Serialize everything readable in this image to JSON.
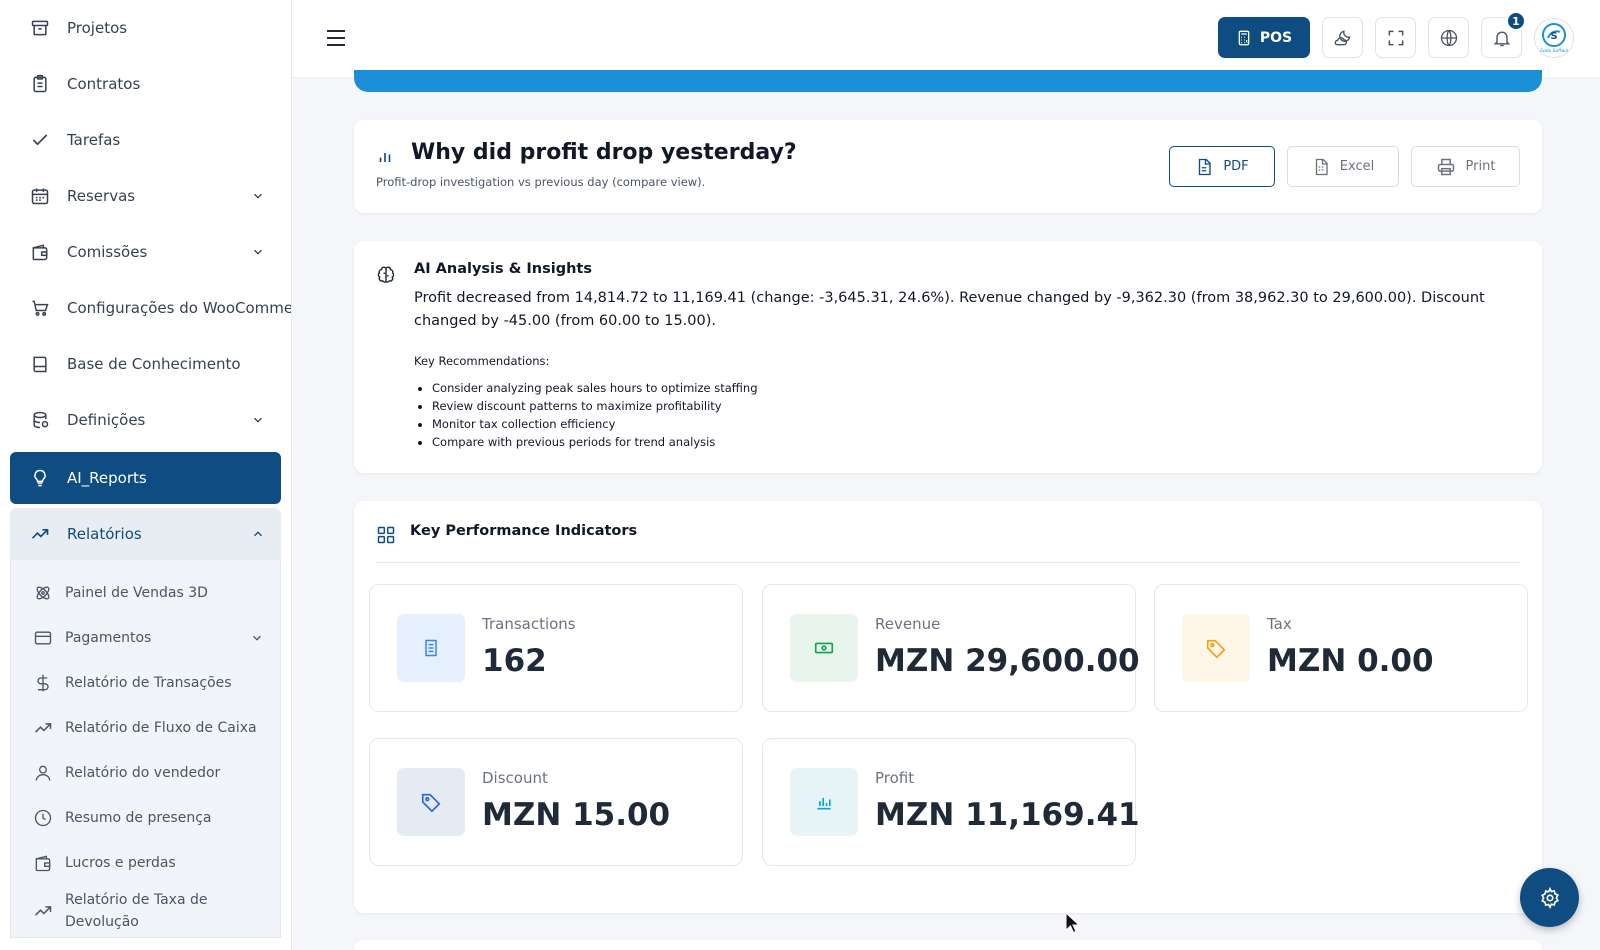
{
  "sidebar": {
    "items": [
      {
        "label": "Projetos",
        "icon": "archive-icon"
      },
      {
        "label": "Contratos",
        "icon": "clipboard-icon"
      },
      {
        "label": "Tarefas",
        "icon": "check-icon"
      },
      {
        "label": "Reservas",
        "icon": "calendar-icon"
      },
      {
        "label": "Comissões",
        "icon": "wallet-icon"
      },
      {
        "label": "Configurações do WooCommerce",
        "icon": "cart-icon"
      },
      {
        "label": "Base de Conhecimento",
        "icon": "book-icon"
      },
      {
        "label": "Definições",
        "icon": "database-icon"
      },
      {
        "label": "AI_Reports",
        "icon": "lightbulb-icon"
      },
      {
        "label": "Relatórios",
        "icon": "trending-up-icon"
      }
    ],
    "submenu": [
      {
        "label": "Painel de Vendas 3D",
        "icon": "atom-icon"
      },
      {
        "label": "Pagamentos",
        "icon": "credit-card-icon"
      },
      {
        "label": "Relatório de Transações",
        "icon": "dollar-icon"
      },
      {
        "label": "Relatório de Fluxo de Caixa",
        "icon": "trending-up-icon"
      },
      {
        "label": "Relatório do vendedor",
        "icon": "user-icon"
      },
      {
        "label": "Resumo de presença",
        "icon": "clock-icon"
      },
      {
        "label": "Lucros e perdas",
        "icon": "wallet-icon"
      },
      {
        "label": "Relatório de Taxa de Devolução",
        "icon": "trending-up-icon"
      }
    ]
  },
  "topbar": {
    "pos_label": "POS",
    "notification_count": "1",
    "logo_text": "Soda Softwa"
  },
  "report": {
    "title": "Why did profit drop yesterday?",
    "subtitle": "Profit-drop investigation vs previous day (compare view).",
    "export": {
      "pdf": "PDF",
      "excel": "Excel",
      "print": "Print"
    }
  },
  "ai": {
    "heading": "AI Analysis & Insights",
    "paragraph": "Profit decreased from 14,814.72 to 11,169.41 (change: -3,645.31, 24.6%). Revenue changed by -9,362.30 (from 38,962.30 to 29,600.00). Discount changed by -45.00 (from 60.00 to 15.00).",
    "recommendations_title": "Key Recommendations:",
    "recommendations": [
      "Consider analyzing peak sales hours to optimize staffing",
      "Review discount patterns to maximize profitability",
      "Monitor tax collection efficiency",
      "Compare with previous periods for trend analysis"
    ]
  },
  "kpis": {
    "heading": "Key Performance Indicators",
    "items": [
      {
        "label": "Transactions",
        "value": "162",
        "icon": "document-icon",
        "color": "#3b82f6",
        "bg": "#e6f0fd"
      },
      {
        "label": "Revenue",
        "value": "MZN 29,600.00",
        "icon": "cash-icon",
        "color": "#16a34a",
        "bg": "#e7f5ec"
      },
      {
        "label": "Tax",
        "value": "MZN 0.00",
        "icon": "tag-icon",
        "color": "#f59e0b",
        "bg": "#fef6e7"
      },
      {
        "label": "Discount",
        "value": "MZN 15.00",
        "icon": "tag-icon",
        "color": "#2563eb",
        "bg": "#e5ebf3"
      },
      {
        "label": "Profit",
        "value": "MZN 11,169.41",
        "icon": "bar-chart-icon",
        "color": "#0ea5c9",
        "bg": "#e6f4f8"
      }
    ]
  },
  "colors": {
    "primary": "#0f4c81",
    "accent": "#1a8fd8"
  }
}
